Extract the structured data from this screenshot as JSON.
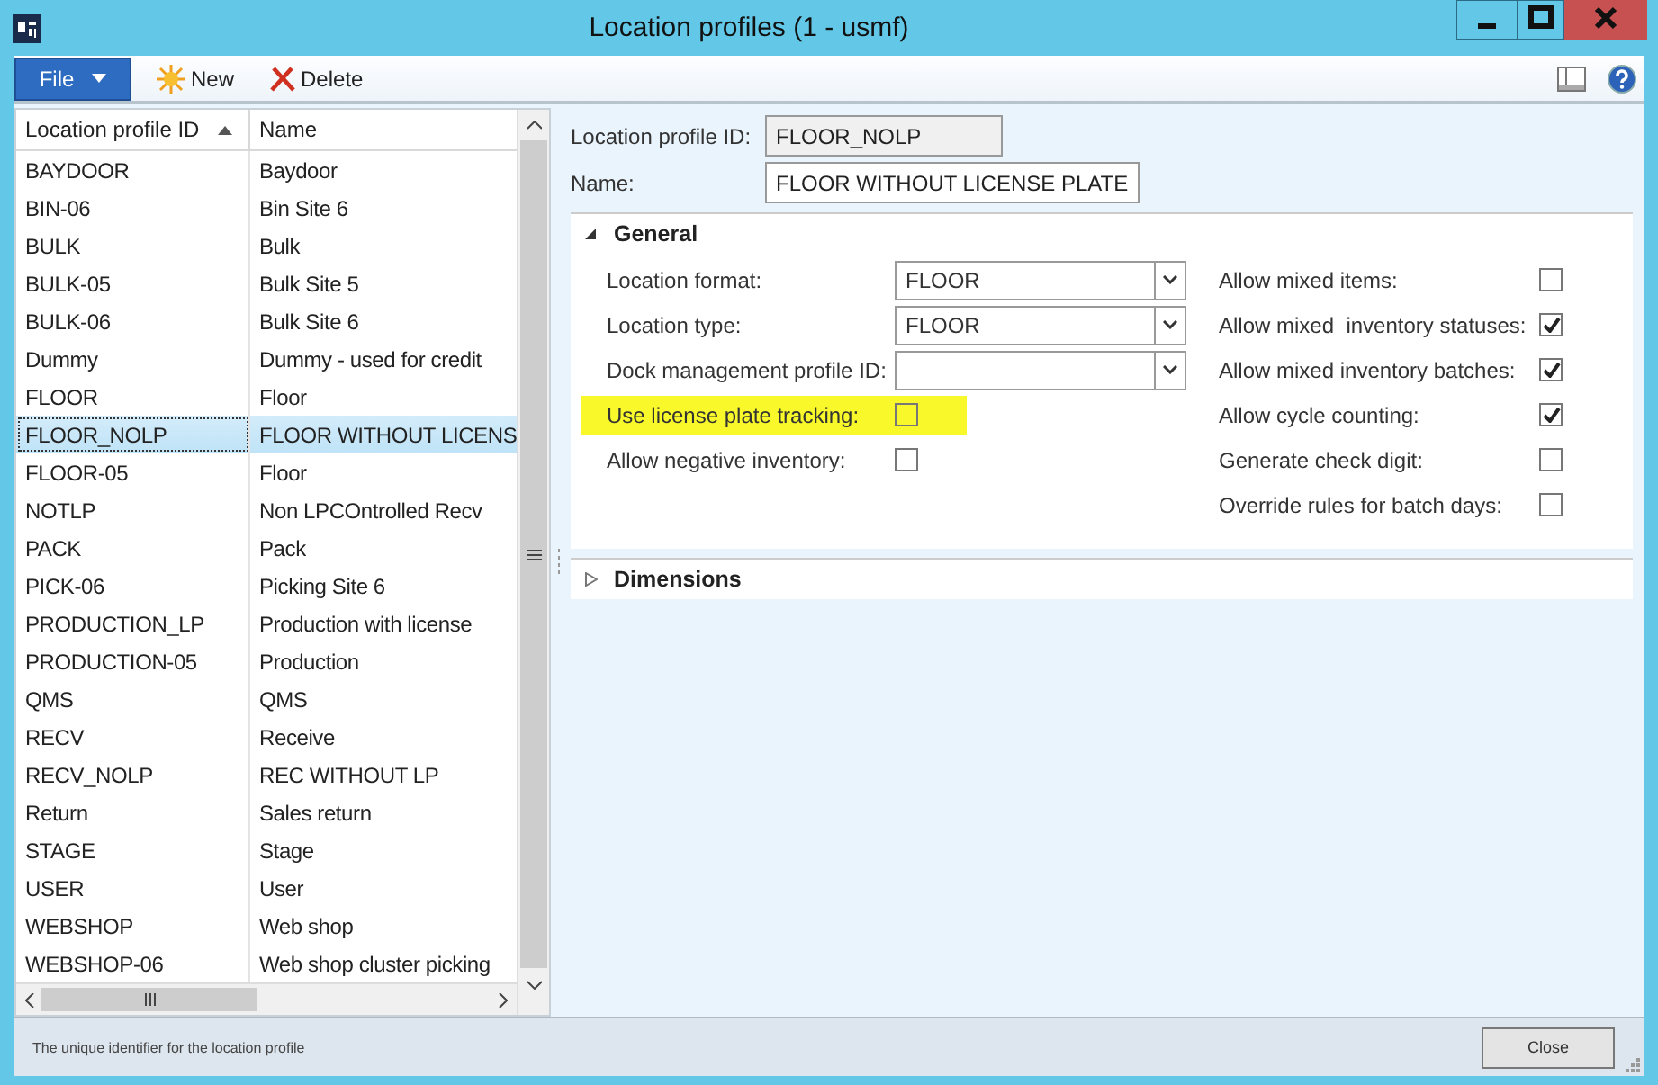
{
  "window": {
    "title": "Location profiles (1 - usmf)"
  },
  "toolbar": {
    "file": "File",
    "new": "New",
    "delete": "Delete"
  },
  "grid": {
    "columns": [
      {
        "label": "Location profile ID",
        "sorted": true
      },
      {
        "label": "Name",
        "sorted": false
      }
    ],
    "rows": [
      {
        "id": "BAYDOOR",
        "name": "Baydoor",
        "selected": false
      },
      {
        "id": "BIN-06",
        "name": "Bin Site 6",
        "selected": false
      },
      {
        "id": "BULK",
        "name": "Bulk",
        "selected": false
      },
      {
        "id": "BULK-05",
        "name": "Bulk Site 5",
        "selected": false
      },
      {
        "id": "BULK-06",
        "name": "Bulk Site 6",
        "selected": false
      },
      {
        "id": "Dummy",
        "name": "Dummy - used for credit",
        "selected": false
      },
      {
        "id": "FLOOR",
        "name": "Floor",
        "selected": false
      },
      {
        "id": "FLOOR_NOLP",
        "name": "FLOOR WITHOUT LICENS",
        "selected": true
      },
      {
        "id": "FLOOR-05",
        "name": "Floor",
        "selected": false
      },
      {
        "id": "NOTLP",
        "name": "Non LPCOntrolled Recv",
        "selected": false
      },
      {
        "id": "PACK",
        "name": "Pack",
        "selected": false
      },
      {
        "id": "PICK-06",
        "name": "Picking Site 6",
        "selected": false
      },
      {
        "id": "PRODUCTION_LP",
        "name": "Production with license",
        "selected": false
      },
      {
        "id": "PRODUCTION-05",
        "name": "Production",
        "selected": false
      },
      {
        "id": "QMS",
        "name": "QMS",
        "selected": false
      },
      {
        "id": "RECV",
        "name": "Receive",
        "selected": false
      },
      {
        "id": "RECV_NOLP",
        "name": "REC WITHOUT LP",
        "selected": false
      },
      {
        "id": "Return",
        "name": "Sales return",
        "selected": false
      },
      {
        "id": "STAGE",
        "name": "Stage",
        "selected": false
      },
      {
        "id": "USER",
        "name": "User",
        "selected": false
      },
      {
        "id": "WEBSHOP",
        "name": "Web shop",
        "selected": false
      },
      {
        "id": "WEBSHOP-06",
        "name": "Web shop cluster picking",
        "selected": false
      }
    ]
  },
  "header_fields": [
    {
      "label": "Location profile ID:",
      "value": "FLOOR_NOLP",
      "disabled": true
    },
    {
      "label": "Name:",
      "value": "FLOOR WITHOUT LICENSE PLATE",
      "disabled": false
    }
  ],
  "sections": [
    {
      "title": "General",
      "expanded": true,
      "left_fields": [
        {
          "kind": "dropdown",
          "label": "Location format:",
          "value": "FLOOR",
          "highlighted": false
        },
        {
          "kind": "dropdown",
          "label": "Location type:",
          "value": "FLOOR",
          "highlighted": false
        },
        {
          "kind": "dropdown",
          "label": "Dock management profile ID:",
          "highlighted": false
        },
        {
          "kind": "checkbox",
          "label": "Use license plate tracking:",
          "checked": false,
          "highlighted": true
        },
        {
          "kind": "checkbox",
          "label": "Allow negative inventory:",
          "checked": false,
          "highlighted": false
        }
      ],
      "right_fields": [
        {
          "kind": "checkbox",
          "label": "Allow mixed items:",
          "checked": false
        },
        {
          "kind": "checkbox",
          "label": "Allow mixed  inventory statuses:",
          "checked": true
        },
        {
          "kind": "checkbox",
          "label": "Allow mixed inventory batches:",
          "checked": true
        },
        {
          "kind": "checkbox",
          "label": "Allow cycle counting:",
          "checked": true
        },
        {
          "kind": "checkbox",
          "label": "Generate check digit:",
          "checked": false
        },
        {
          "kind": "checkbox",
          "label": "Override rules for batch days:",
          "checked": false
        }
      ]
    },
    {
      "title": "Dimensions",
      "expanded": false
    }
  ],
  "status_bar": {
    "text": "The unique identifier for the location profile",
    "button": "Close"
  }
}
